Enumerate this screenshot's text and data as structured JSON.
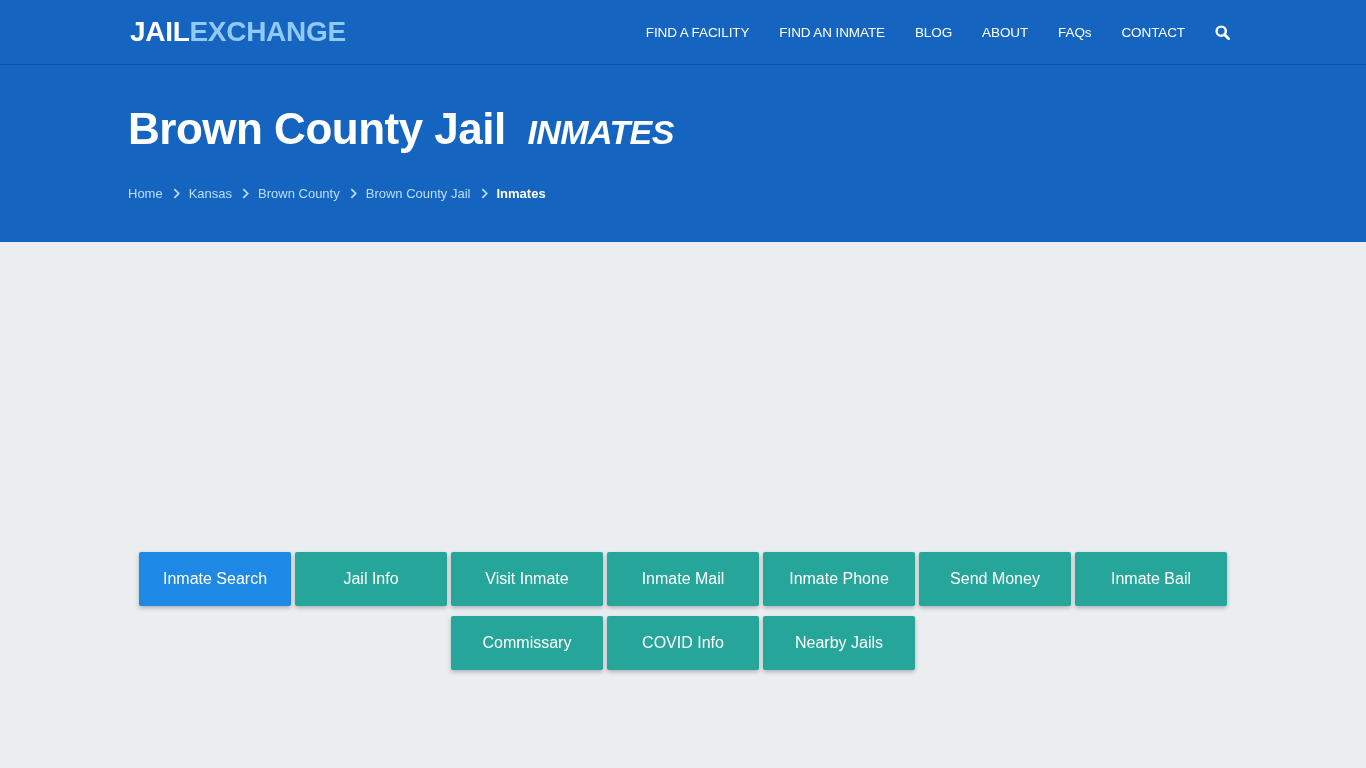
{
  "header": {
    "logo": {
      "first": "JAIL",
      "second": "EXCHANGE"
    },
    "nav": [
      {
        "label": "FIND A FACILITY"
      },
      {
        "label": "FIND AN INMATE"
      },
      {
        "label": "BLOG"
      },
      {
        "label": "ABOUT"
      },
      {
        "label": "FAQs"
      },
      {
        "label": "CONTACT"
      }
    ]
  },
  "hero": {
    "title": "Brown County Jail *INMATES*",
    "breadcrumb": [
      {
        "label": "Home",
        "current": false
      },
      {
        "label": "Kansas",
        "current": false
      },
      {
        "label": "Brown County",
        "current": false
      },
      {
        "label": "Brown County Jail",
        "current": false
      },
      {
        "label": "Inmates",
        "current": true
      }
    ]
  },
  "buttons": [
    {
      "label": "Inmate Search",
      "selected": true
    },
    {
      "label": "Jail Info",
      "selected": false
    },
    {
      "label": "Visit Inmate",
      "selected": false
    },
    {
      "label": "Inmate Mail",
      "selected": false
    },
    {
      "label": "Inmate Phone",
      "selected": false
    },
    {
      "label": "Send Money",
      "selected": false
    },
    {
      "label": "Inmate Bail",
      "selected": false
    },
    {
      "label": "Commissary",
      "selected": false
    },
    {
      "label": "COVID Info",
      "selected": false
    },
    {
      "label": "Nearby Jails",
      "selected": false
    }
  ]
}
